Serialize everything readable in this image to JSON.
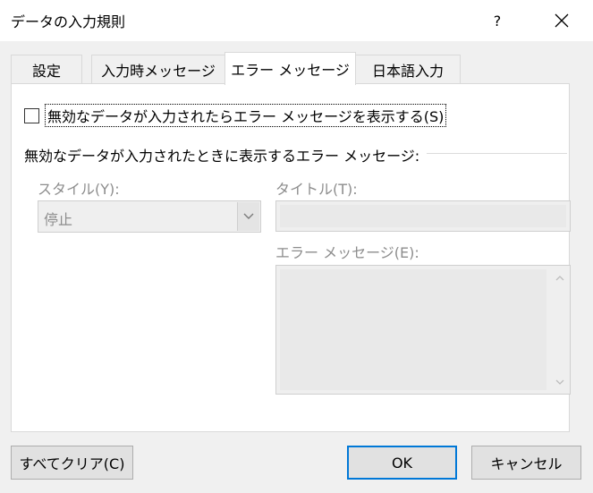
{
  "window": {
    "title": "データの入力規則",
    "help_label": "?",
    "close_icon": "close-icon"
  },
  "tabs": [
    {
      "label": "設定",
      "active": false
    },
    {
      "label": "入力時メッセージ",
      "active": false
    },
    {
      "label": "エラー メッセージ",
      "active": true
    },
    {
      "label": "日本語入力",
      "active": false
    }
  ],
  "error_tab": {
    "show_alert_label": "無効なデータが入力されたらエラー メッセージを表示する(S)",
    "show_alert_checked": false,
    "group_label": "無効なデータが入力されたときに表示するエラー メッセージ:",
    "style_label": "スタイル(Y):",
    "style_value": "停止",
    "title_label": "タイトル(T):",
    "title_value": "",
    "message_label": "エラー メッセージ(E):",
    "message_value": ""
  },
  "buttons": {
    "clear_all": "すべてクリア(C)",
    "ok": "OK",
    "cancel": "キャンセル"
  },
  "colors": {
    "default_button_border": "#0078d7",
    "disabled_text": "#8d8d8d"
  }
}
